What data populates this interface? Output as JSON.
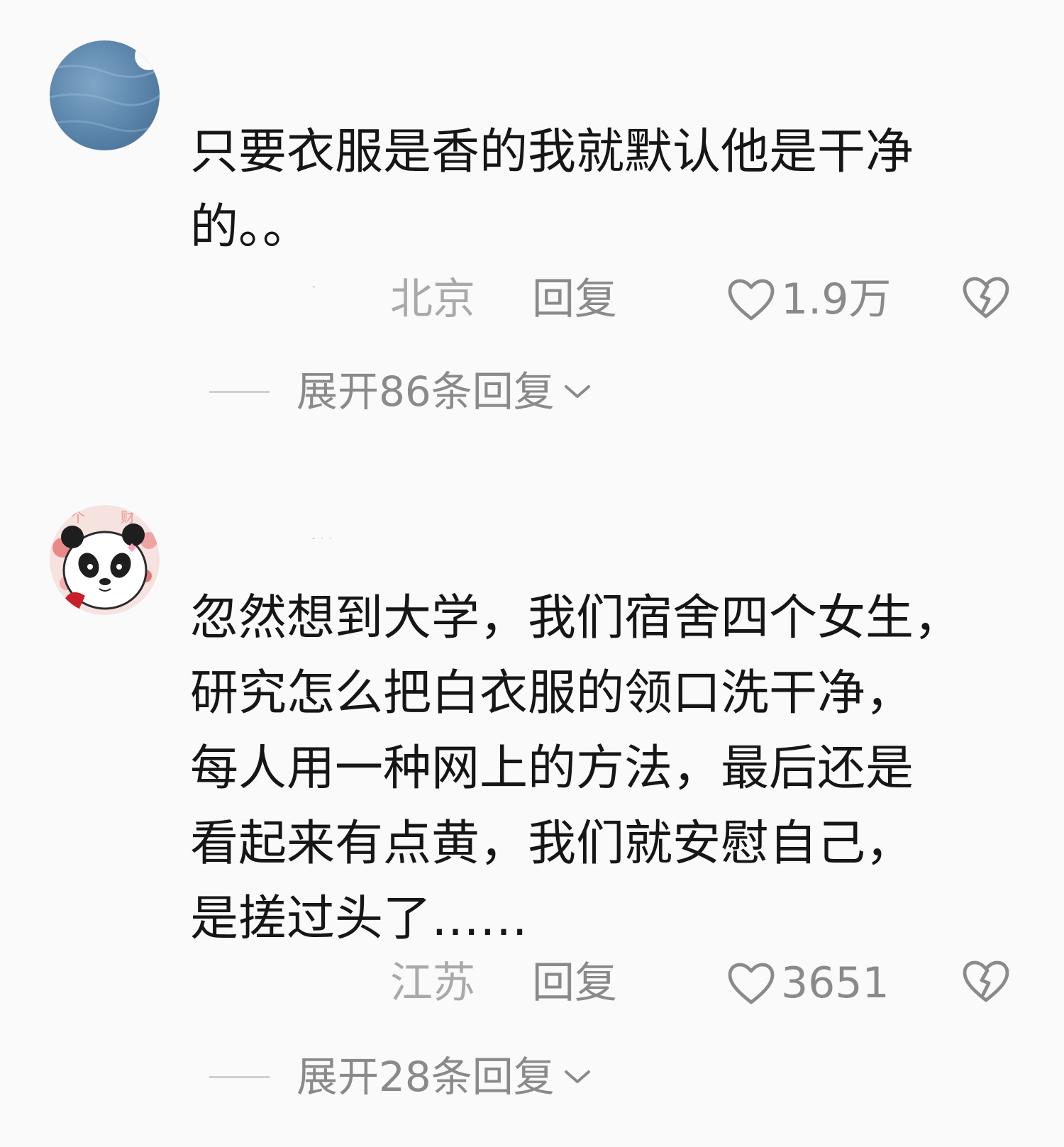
{
  "comments": [
    {
      "username": "、",
      "text": "只要衣服是香的我就默认他是干净\n的。。",
      "location": "北京",
      "reply_label": "回复",
      "like_count": "1.9万",
      "expand_label": "展开86条回复"
    },
    {
      "username": "- · ·",
      "text": "忽然想到大学，我们宿舍四个女生，\n研究怎么把白衣服的领口洗干净，\n每人用一种网上的方法，最后还是\n看起来有点黄，我们就安慰自己，\n是搓过头了……",
      "location": "江苏",
      "reply_label": "回复",
      "like_count": "3651",
      "expand_label": "展开28条回复"
    }
  ]
}
